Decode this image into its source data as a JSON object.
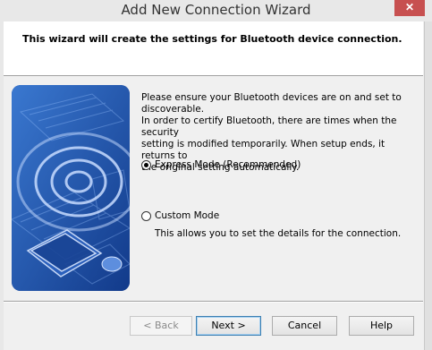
{
  "window": {
    "title": "Add New Connection Wizard",
    "close_glyph": "✕"
  },
  "header": {
    "text": "This wizard will create the settings for Bluetooth device connection."
  },
  "description": {
    "lines": [
      "Please ensure your Bluetooth devices are on and set to",
      "discoverable.",
      "In order to certify Bluetooth, there are times when the security",
      "setting is modified temporarily. When setup ends, it returns to",
      "the original setting automatically."
    ]
  },
  "modes": {
    "express_label": "Express Mode (Recommended)",
    "express_selected": true,
    "custom_label": "Custom Mode",
    "custom_selected": false,
    "custom_description": "This allows you to set the details for the connection."
  },
  "buttons": {
    "back": "< Back",
    "next": "Next >",
    "cancel": "Cancel",
    "help": "Help"
  },
  "colors": {
    "illustration_blue": "#1f4fa8",
    "close_red": "#c75050"
  }
}
